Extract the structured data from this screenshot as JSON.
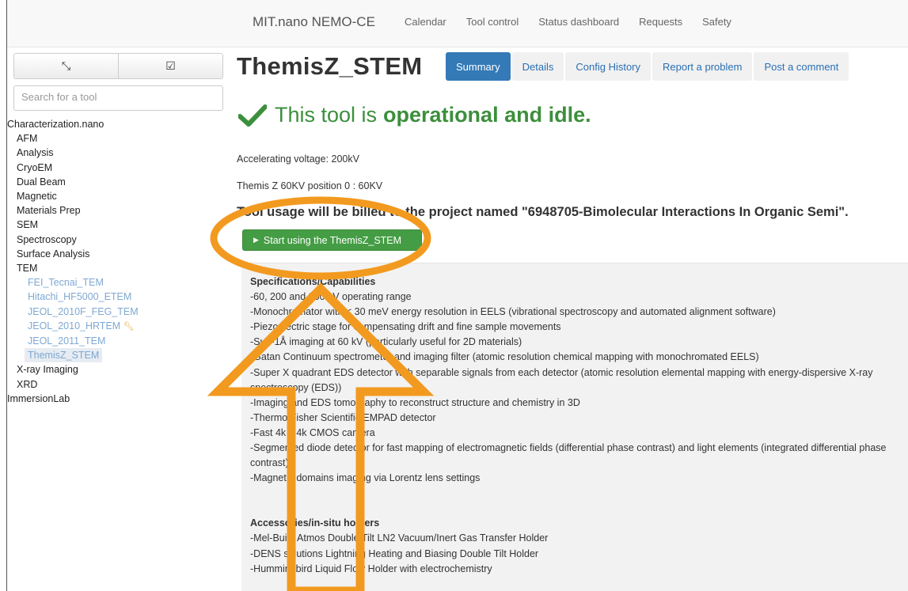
{
  "navbar": {
    "brand": "MIT.nano NEMO-CE",
    "links": [
      "Calendar",
      "Tool control",
      "Status dashboard",
      "Requests",
      "Safety"
    ]
  },
  "sidebar": {
    "collapse_icon": "⤡",
    "check_icon": "☑",
    "search_placeholder": "Search for a tool",
    "tree": {
      "root": "Characterization.nano",
      "categories": [
        "AFM",
        "Analysis",
        "CryoEM",
        "Dual Beam",
        "Magnetic",
        "Materials Prep",
        "SEM",
        "Spectroscopy",
        "Surface Analysis",
        "TEM"
      ],
      "tem_tools": [
        "FEI_Tecnai_TEM",
        "Hitachi_HF5000_ETEM",
        "JEOL_2010F_FEG_TEM",
        "JEOL_2010_HRTEM",
        "JEOL_2011_TEM",
        "ThemisZ_STEM"
      ],
      "after_tem": [
        "X-ray Imaging",
        "XRD"
      ],
      "root2": "ImmersionLab"
    }
  },
  "main": {
    "tool_name": "ThemisZ_STEM",
    "tabs": [
      "Summary",
      "Details",
      "Config History",
      "Report a problem",
      "Post a comment"
    ],
    "status_prefix": "This tool is",
    "status_bold": "operational and idle.",
    "accelerating_voltage": "Accelerating voltage: 200kV",
    "position": "Themis Z 60KV position 0 : 60KV",
    "billing": "Tool usage will be billed to the project named \"6948705-Bimolecular Interactions In Organic Semi\".",
    "start_button": "Start using the ThemisZ_STEM",
    "specs_heading": "Specifications/Capabilities",
    "specs": [
      "-60, 200 and 300 kV operating range",
      "-Monochromator with < 30 meV energy resolution in EELS (vibrational spectroscopy and automated alignment software)",
      "-Piezoelectric stage for compensating drift and fine sample movements",
      "-Sub-1Å imaging at 60 kV (particularly useful for 2D materials)",
      "-Gatan Continuum spectrometer and imaging filter (atomic resolution chemical mapping with monochromated EELS)",
      "-Super X quadrant EDS detector with separable signals from each detector (atomic resolution elemental mapping with energy-dispersive X-ray spectroscopy (EDS))",
      "-Imaging and EDS tomography to reconstruct structure and chemistry in 3D",
      "-Thermo Fisher Scientific EMPAD detector",
      "-Fast 4k x 4k CMOS camera",
      "-Segmented diode detector for fast mapping of electromagnetic fields (differential phase contrast) and light elements (integrated differential phase contrast)",
      "-Magnetic domains imaging via Lorentz lens settings"
    ],
    "acc_heading": "Accessories/in-situ holders",
    "accessories": [
      "-Mel-Build Atmos Double Tilt LN2 Vacuum/Inert Gas Transfer Holder",
      "-DENS solutions Lightning Heating and Biasing Double Tilt Holder",
      "-Hummingbird Liquid Flow Holder with electrochemistry"
    ]
  },
  "colors": {
    "annotation": "#f29a1f",
    "success": "#3c8f3c",
    "primary": "#337ab7"
  }
}
